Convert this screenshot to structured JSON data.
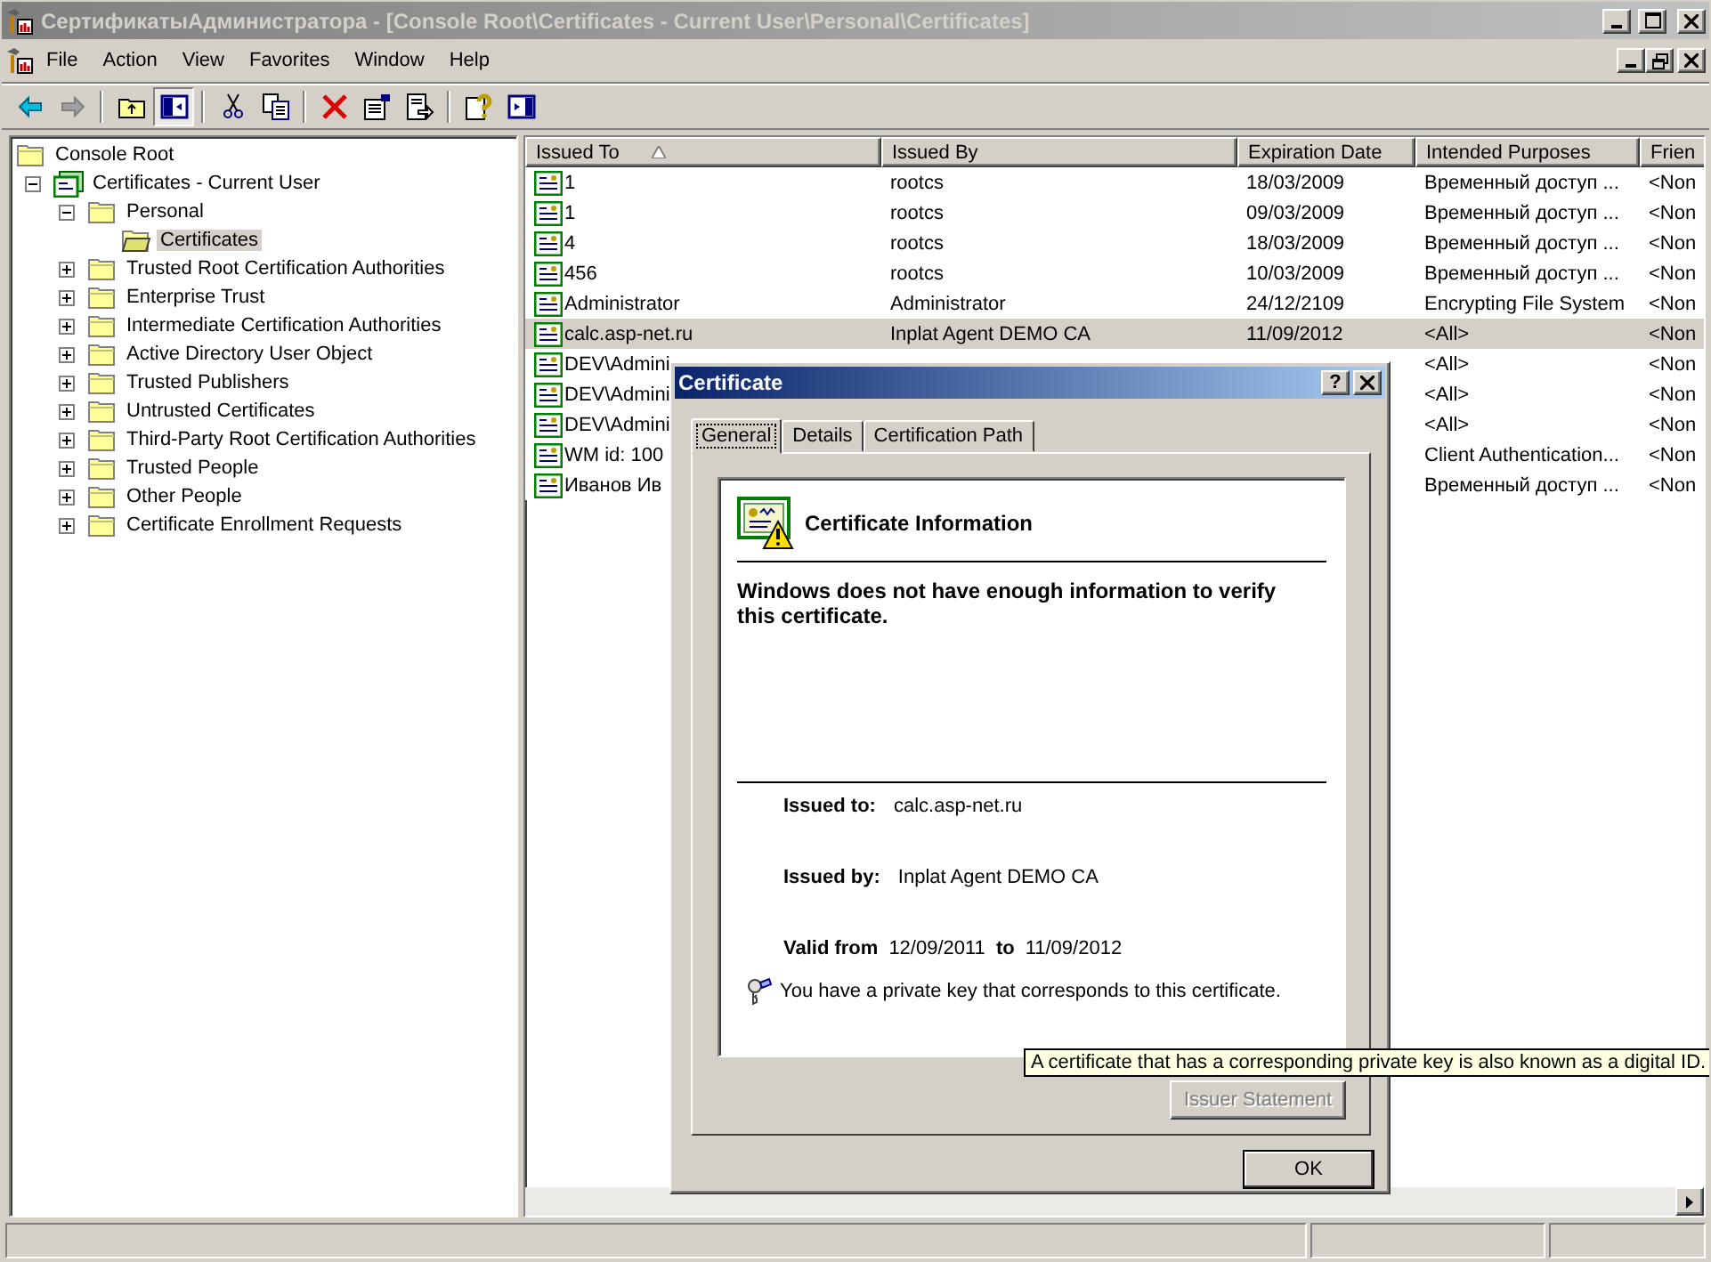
{
  "window": {
    "title": "СертификатыАдминистратора - [Console Root\\Certificates - Current User\\Personal\\Certificates]"
  },
  "menu": [
    {
      "label": "File"
    },
    {
      "label": "Action"
    },
    {
      "label": "View"
    },
    {
      "label": "Favorites"
    },
    {
      "label": "Window"
    },
    {
      "label": "Help"
    }
  ],
  "toolbar": [
    {
      "kind": "back",
      "pressed": false
    },
    {
      "kind": "forward",
      "pressed": false
    },
    {
      "kind": "separator"
    },
    {
      "kind": "up",
      "pressed": false
    },
    {
      "kind": "tree",
      "pressed": true
    },
    {
      "kind": "separator"
    },
    {
      "kind": "cut",
      "pressed": false
    },
    {
      "kind": "copy",
      "pressed": false
    },
    {
      "kind": "separator"
    },
    {
      "kind": "delete",
      "pressed": false
    },
    {
      "kind": "properties",
      "pressed": false
    },
    {
      "kind": "export",
      "pressed": false
    },
    {
      "kind": "separator"
    },
    {
      "kind": "help",
      "pressed": false
    },
    {
      "kind": "pane",
      "pressed": false
    }
  ],
  "tree": [
    {
      "label": "Console Root",
      "kind": "folder",
      "selected": false,
      "children": [
        {
          "label": "Certificates - Current User",
          "kind": "snapin",
          "expanded": true,
          "selected": false,
          "children": [
            {
              "label": "Personal",
              "kind": "folder",
              "expanded": true,
              "selected": false,
              "children": [
                {
                  "label": "Certificates",
                  "kind": "open-folder",
                  "selected": true
                }
              ]
            },
            {
              "label": "Trusted Root Certification Authorities",
              "kind": "folder",
              "expanded": false,
              "selected": false
            },
            {
              "label": "Enterprise Trust",
              "kind": "folder",
              "expanded": false,
              "selected": false
            },
            {
              "label": "Intermediate Certification Authorities",
              "kind": "folder",
              "expanded": false,
              "selected": false
            },
            {
              "label": "Active Directory User Object",
              "kind": "folder",
              "expanded": false,
              "selected": false
            },
            {
              "label": "Trusted Publishers",
              "kind": "folder",
              "expanded": false,
              "selected": false
            },
            {
              "label": "Untrusted Certificates",
              "kind": "folder",
              "expanded": false,
              "selected": false
            },
            {
              "label": "Third-Party Root Certification Authorities",
              "kind": "folder",
              "expanded": false,
              "selected": false
            },
            {
              "label": "Trusted People",
              "kind": "folder",
              "expanded": false,
              "selected": false
            },
            {
              "label": "Other People",
              "kind": "folder",
              "expanded": false,
              "selected": false
            },
            {
              "label": "Certificate Enrollment Requests",
              "kind": "folder",
              "expanded": false,
              "selected": false
            }
          ]
        }
      ]
    }
  ],
  "table": {
    "columns": [
      {
        "label": "Issued To",
        "sorted": true
      },
      {
        "label": "Issued By",
        "sorted": false
      },
      {
        "label": "Expiration Date",
        "sorted": false
      },
      {
        "label": "Intended Purposes",
        "sorted": false
      },
      {
        "label": "Frien",
        "sorted": false
      }
    ],
    "rows": [
      {
        "issued_to": "1",
        "issued_by": "rootcs",
        "expiration_date": "18/03/2009",
        "intended_purposes": "Временный доступ ...",
        "column_5": "<Non",
        "selected": false
      },
      {
        "issued_to": "1",
        "issued_by": "rootcs",
        "expiration_date": "09/03/2009",
        "intended_purposes": "Временный доступ ...",
        "column_5": "<Non",
        "selected": false
      },
      {
        "issued_to": "4",
        "issued_by": "rootcs",
        "expiration_date": "18/03/2009",
        "intended_purposes": "Временный доступ ...",
        "column_5": "<Non",
        "selected": false
      },
      {
        "issued_to": "456",
        "issued_by": "rootcs",
        "expiration_date": "10/03/2009",
        "intended_purposes": "Временный доступ ...",
        "column_5": "<Non",
        "selected": false
      },
      {
        "issued_to": "Administrator",
        "issued_by": "Administrator",
        "expiration_date": "24/12/2109",
        "intended_purposes": "Encrypting File System",
        "column_5": "<Non",
        "selected": false
      },
      {
        "issued_to": "calc.asp-net.ru",
        "issued_by": "Inplat Agent DEMO CA",
        "expiration_date": "11/09/2012",
        "intended_purposes": "<All>",
        "column_5": "<Non",
        "selected": true
      },
      {
        "issued_to": "DEV\\Admini",
        "intended_purposes": "<All>",
        "column_5": "<Non",
        "selected": false
      },
      {
        "issued_to": "DEV\\Admini",
        "intended_purposes": "<All>",
        "column_5": "<Non",
        "selected": false
      },
      {
        "issued_to": "DEV\\Admini",
        "intended_purposes": "<All>",
        "column_5": "<Non",
        "selected": false
      },
      {
        "issued_to": "WM id: 100",
        "intended_purposes": "Client Authentication...",
        "column_5": "<Non",
        "selected": false
      },
      {
        "issued_to": "Иванов Ив",
        "intended_purposes": "Временный доступ ...",
        "column_5": "<Non",
        "selected": false
      }
    ]
  },
  "dialog": {
    "title": "Certificate",
    "help_button": "?",
    "tabs": [
      {
        "label": "General",
        "selected": true
      },
      {
        "label": "Details",
        "selected": false
      },
      {
        "label": "Certification Path",
        "selected": false
      }
    ],
    "heading": "Certificate Information",
    "warning": "Windows does not have enough information to verify this certificate.",
    "issued_to": {
      "label": "Issued to:",
      "value": "calc.asp-net.ru"
    },
    "issued_by": {
      "label": "Issued by:",
      "value": "Inplat Agent DEMO CA"
    },
    "valid": {
      "from_label": "Valid from",
      "from": "12/09/2011",
      "to_label": "to",
      "to": "11/09/2012"
    },
    "key_note": "You have a private key that corresponds to this certificate.",
    "issuer_button": {
      "label": "Issuer Statement",
      "disabled": true
    },
    "ok_button": "OK"
  },
  "tooltip": "A certificate that has a corresponding private key is also known as a digital ID."
}
